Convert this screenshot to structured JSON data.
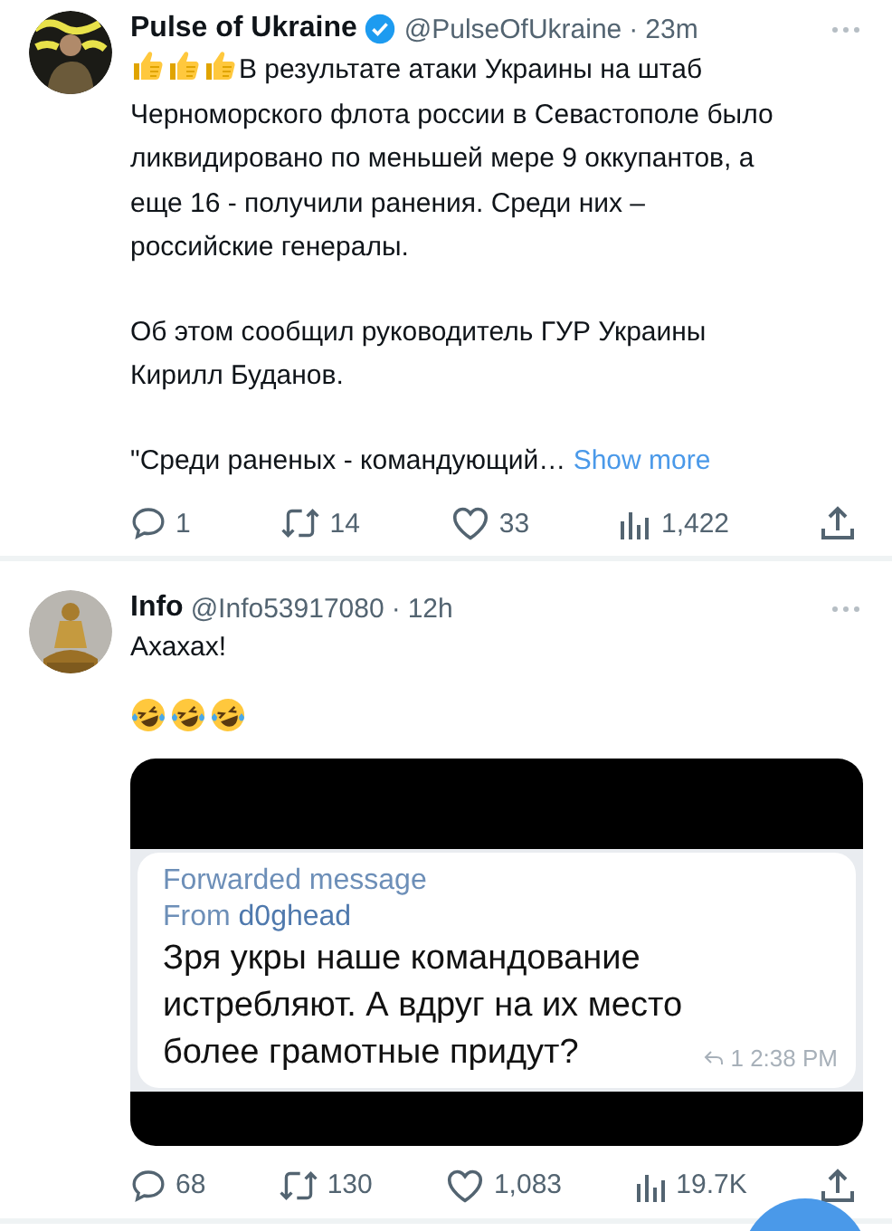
{
  "tweets": [
    {
      "name": "Pulse of Ukraine",
      "verified": true,
      "handle": "@PulseOfUkraine",
      "separator": "·",
      "time": "23m",
      "avatar": {
        "kind": "poster"
      },
      "lead_emojis": [
        {
          "kind": "thumbs-up"
        },
        {
          "kind": "thumbs-up"
        },
        {
          "kind": "thumbs-up"
        }
      ],
      "paragraphs": [
        "В результате атаки Украины на штаб Черноморского флота россии в Севастополе было ликвидировано по меньшей мере 9 оккупантов, а еще 16 - получили ранения. Среди них – российские генералы.",
        "Об этом сообщил руководитель ГУР Украины Кирилл Буданов.",
        "\"Среди раненых - командующий…"
      ],
      "show_more": "Show more",
      "stats": {
        "replies": "1",
        "reposts": "14",
        "likes": "33",
        "views": "1,422"
      }
    },
    {
      "name": "Info",
      "verified": false,
      "handle": "@Info53917080",
      "separator": "·",
      "time": "12h",
      "avatar": {
        "kind": "statue"
      },
      "paragraphs": [
        "Ахахах!"
      ],
      "emoji_row": [
        {
          "kind": "laughing"
        },
        {
          "kind": "laughing"
        },
        {
          "kind": "laughing"
        }
      ],
      "media": {
        "kind": "chat-screenshot",
        "forwarded": "Forwarded message",
        "from": "From **d0ghead**",
        "message": "Зря укры наше командование истребляют. А вдруг на их место более грамотные придут?",
        "reply_count": "1",
        "time": "2:38 PM"
      },
      "stats": {
        "replies": "68",
        "reposts": "130",
        "likes": "1,083",
        "views": "19.7K"
      }
    }
  ],
  "compose_button": {
    "visible": true
  }
}
